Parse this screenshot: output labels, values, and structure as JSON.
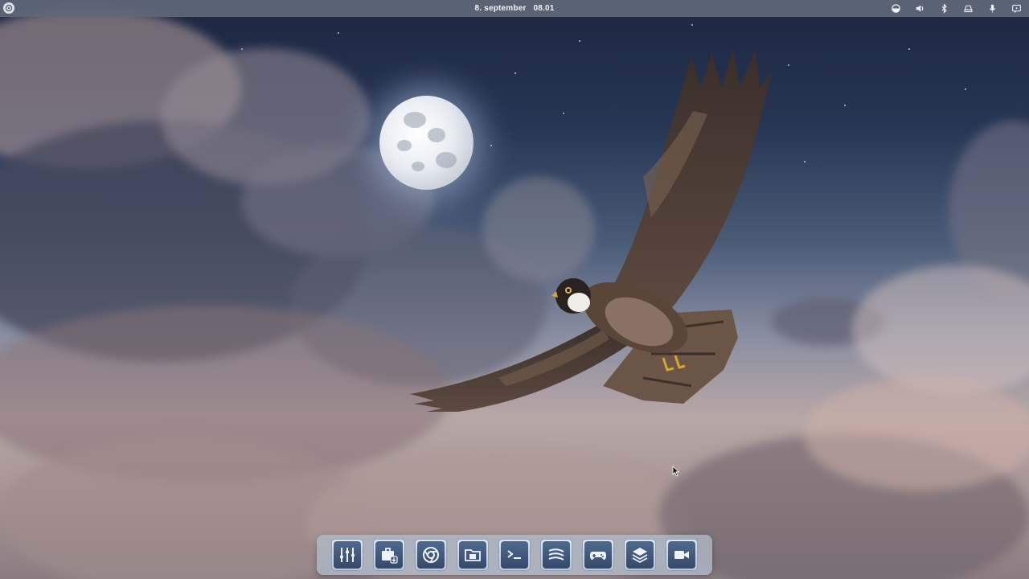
{
  "top_panel": {
    "clock": "8. september   08.01",
    "tray_icons": [
      "network-icon",
      "volume-icon",
      "bluetooth-icon",
      "drive-icon",
      "microphone-icon",
      "notifications-icon"
    ]
  },
  "dock": {
    "items": [
      {
        "name": "mixer-settings-icon"
      },
      {
        "name": "software-store-icon"
      },
      {
        "name": "browser-icon"
      },
      {
        "name": "files-icon"
      },
      {
        "name": "terminal-icon"
      },
      {
        "name": "streaming-icon"
      },
      {
        "name": "gamepad-icon"
      },
      {
        "name": "layers-icon"
      },
      {
        "name": "video-camera-icon"
      }
    ]
  },
  "colors": {
    "panel_bg": "#606878",
    "dock_bg": "#b0bac8",
    "icon_fg": "#eef3fa"
  }
}
